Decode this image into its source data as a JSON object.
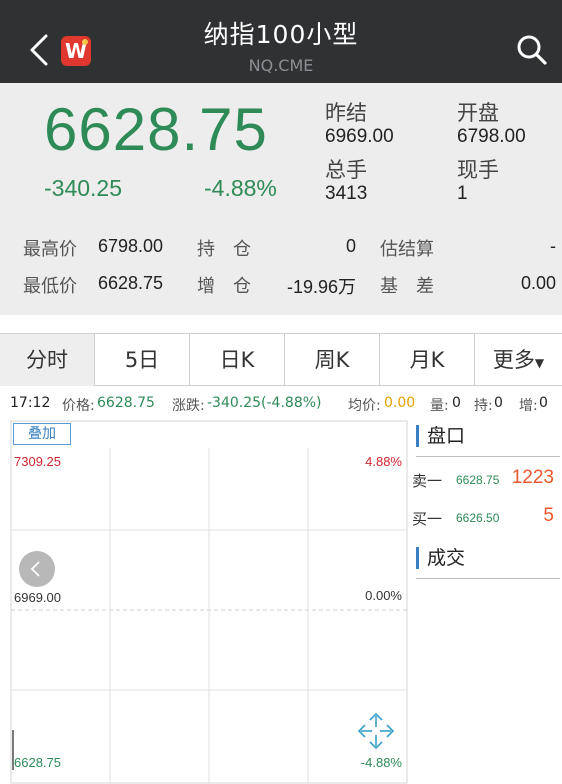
{
  "header": {
    "title": "纳指100小型",
    "symbol": "NQ.CME",
    "logo_text": "W"
  },
  "quote": {
    "price": "6628.75",
    "change": "-340.25",
    "change_pct": "-4.88%",
    "prev_close_label": "昨结",
    "prev_close": "6969.00",
    "open_label": "开盘",
    "open": "6798.00",
    "volume_label": "总手",
    "volume": "3413",
    "last_vol_label": "现手",
    "last_vol": "1",
    "high_label": "最高价",
    "high": "6798.00",
    "low_label": "最低价",
    "low": "6628.75",
    "oi_label": "持　仓",
    "oi": "0",
    "oi_chg_label": "增　仓",
    "oi_chg": "-19.96万",
    "est_settle_label": "估结算",
    "est_settle": "-",
    "basis_label": "基　差",
    "basis": "0.00"
  },
  "tabs": [
    {
      "label": "分时"
    },
    {
      "label": "5日"
    },
    {
      "label": "日K"
    },
    {
      "label": "周K"
    },
    {
      "label": "月K"
    },
    {
      "label": "更多"
    }
  ],
  "info_line": {
    "time": "17:12",
    "price_label": "价格:",
    "price": "6628.75",
    "chg_label": "涨跌:",
    "chg": "-340.25(-4.88%)",
    "avg_label": "均价:",
    "avg": "0.00",
    "vol_label": "量:",
    "vol": "0",
    "oi_label": "持:",
    "oi": "0",
    "inc_label": "增:",
    "inc": "0"
  },
  "chart": {
    "overlay_label": "叠加",
    "y_top": "7309.25",
    "y_mid": "6969.00",
    "y_bot": "6628.75",
    "pct_top": "4.88%",
    "pct_mid": "0.00%",
    "pct_bot": "-4.88%"
  },
  "order_book": {
    "title": "盘口",
    "ask_label": "卖一",
    "ask_price": "6628.75",
    "ask_vol": "1223",
    "bid_label": "买一",
    "bid_price": "6626.50",
    "bid_vol": "5",
    "trades_title": "成交"
  },
  "colors": {
    "down": "#2e8b57",
    "up": "#d0262f",
    "accent": "#3a7fc2",
    "vol": "#e8582c",
    "avg": "#e6a100"
  }
}
